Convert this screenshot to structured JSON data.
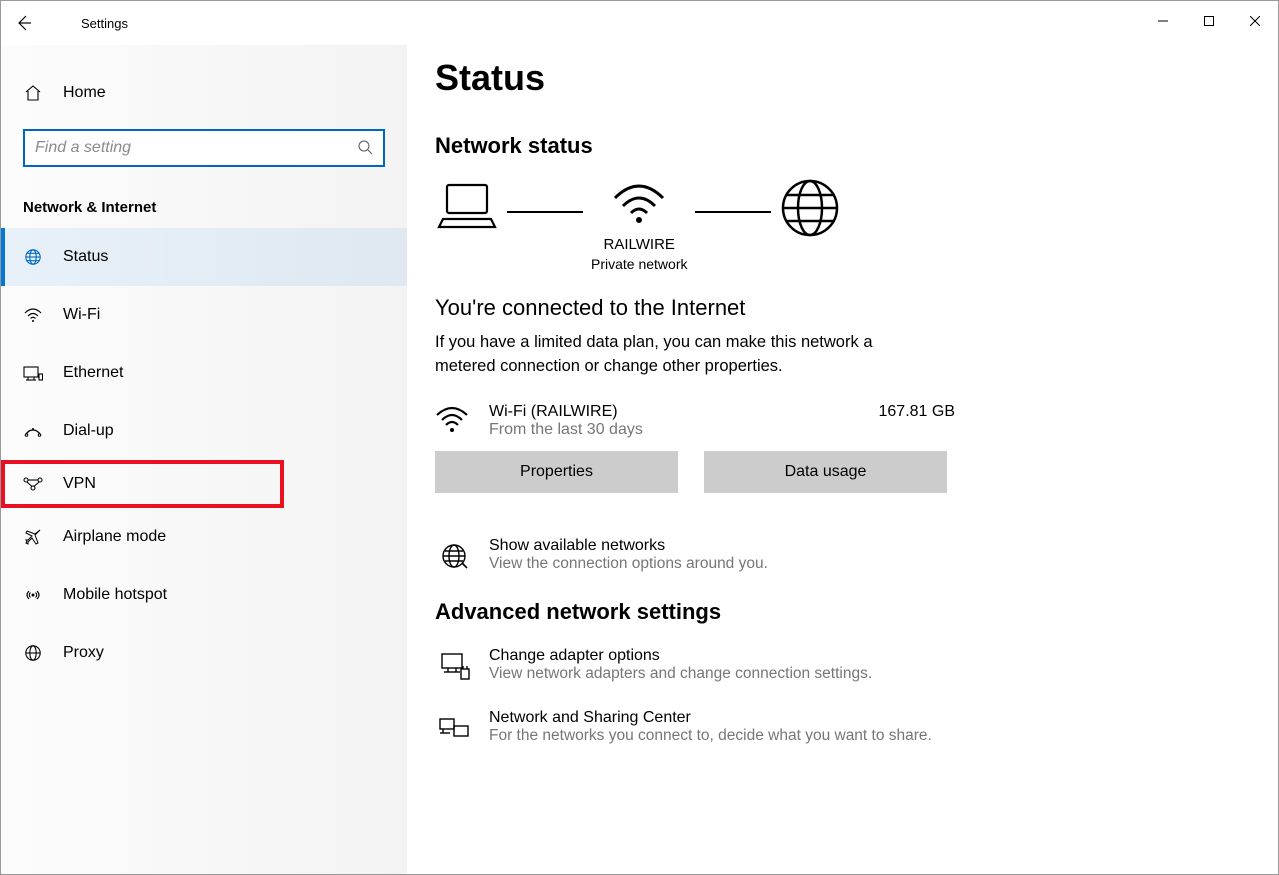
{
  "window": {
    "title": "Settings"
  },
  "sidebar": {
    "home": "Home",
    "search_placeholder": "Find a setting",
    "category": "Network & Internet",
    "items": [
      {
        "label": "Status"
      },
      {
        "label": "Wi-Fi"
      },
      {
        "label": "Ethernet"
      },
      {
        "label": "Dial-up"
      },
      {
        "label": "VPN"
      },
      {
        "label": "Airplane mode"
      },
      {
        "label": "Mobile hotspot"
      },
      {
        "label": "Proxy"
      }
    ]
  },
  "main": {
    "title": "Status",
    "section": "Network status",
    "network": {
      "name": "RAILWIRE",
      "type": "Private network"
    },
    "connected_heading": "You're connected to the Internet",
    "connected_body": "If you have a limited data plan, you can make this network a metered connection or change other properties.",
    "conn": {
      "name": "Wi-Fi (RAILWIRE)",
      "period": "From the last 30 days",
      "usage": "167.81 GB"
    },
    "buttons": {
      "properties": "Properties",
      "usage": "Data usage"
    },
    "available": {
      "title": "Show available networks",
      "sub": "View the connection options around you."
    },
    "advanced": "Advanced network settings",
    "adapter": {
      "title": "Change adapter options",
      "sub": "View network adapters and change connection settings."
    },
    "sharing": {
      "title": "Network and Sharing Center",
      "sub": "For the networks you connect to, decide what you want to share."
    }
  }
}
